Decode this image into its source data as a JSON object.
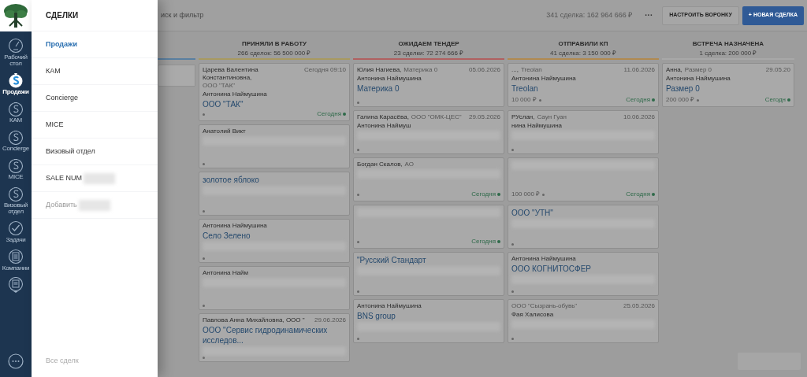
{
  "rail": {
    "items": [
      {
        "label": "Рабочий стол",
        "kind": "dial",
        "selected": false
      },
      {
        "label": "Продажи",
        "kind": "dollar",
        "selected": true
      },
      {
        "label": "КАМ",
        "kind": "dollar",
        "selected": false
      },
      {
        "label": "Concierge",
        "kind": "dollar",
        "selected": false
      },
      {
        "label": "MICE",
        "kind": "dollar",
        "selected": false
      },
      {
        "label": "Визовый отдел",
        "kind": "dollar",
        "selected": false
      },
      {
        "label": "Задачи",
        "kind": "check",
        "selected": false
      },
      {
        "label": "Компании",
        "kind": "list",
        "selected": false
      },
      {
        "kind": "more",
        "selected": false
      }
    ]
  },
  "menu": {
    "title": "СДЕЛКИ",
    "items": [
      {
        "label": "Продажи",
        "kind": "pipeline",
        "selected": true,
        "blurred": false
      },
      {
        "label": "КАМ",
        "kind": "pipeline",
        "selected": false,
        "blurred": false
      },
      {
        "label": "Concierge",
        "kind": "pipeline",
        "selected": false,
        "blurred": false
      },
      {
        "label": "MICE",
        "kind": "pipeline",
        "selected": false,
        "blurred": false
      },
      {
        "label": "Визовый отдел",
        "kind": "pipeline",
        "selected": false,
        "blurred": false
      },
      {
        "label": "SALE NUM",
        "kind": "pipeline",
        "selected": false,
        "blurred": true
      },
      {
        "label": "Добавить",
        "kind": "add",
        "selected": false,
        "blurred": true
      }
    ],
    "footer": "Все сделк"
  },
  "toolbar": {
    "search_placeholder": "иск и фильтр",
    "summary": "341 сделка: 162 964 666 ₽",
    "more": "···",
    "buttons": [
      {
        "label": "НАСТРОИТЬ ВОРОНКУ",
        "kind": "secondary"
      },
      {
        "label": "+ НОВАЯ СДЕЛКА",
        "kind": "primary"
      }
    ]
  },
  "hidden_column": {
    "color": "#5a7fa0"
  },
  "columns": [
    {
      "title": "ПРИНЯЛИ В РАБОТУ",
      "summary": "266 сделок: 56 500 000 ₽",
      "color": "#a89a60",
      "cards": [
        {
          "contact": "Царева Валентина Константиновна,",
          "company": "ООО \"ТАК\"",
          "date": "Сегодня 09:10",
          "manager": "Антонина Наймушина",
          "title": "ООО \"ТАК\"",
          "due": "Сегодня",
          "blurred": false
        },
        {
          "contact": "Анатолий Викт",
          "blurred": true
        },
        {
          "title": "золотое яблоко",
          "blurred": true
        },
        {
          "manager": "Антонина Наймушина",
          "title": "Село Зелено",
          "blurred": true
        },
        {
          "manager": "Антонина Найм",
          "blurred": true
        },
        {
          "contact": "Павлова Анна Михайловна, ООО \"",
          "date": "29.06.2026",
          "title": "ООО \"Сервис гидродинамических исследов...",
          "blurred": true
        }
      ]
    },
    {
      "title": "ОЖИДАЕМ ТЕНДЕР",
      "summary": "23 сделки: 72 274 666 ₽",
      "color": "#b06060",
      "cards": [
        {
          "contact": "Юлия Нагиева,",
          "company": "Материка 0",
          "date": "05.06.2026",
          "manager": "Антонина Наймушина",
          "title": "Материка 0",
          "blurred": false
        },
        {
          "contact": "Галина Карасёва,",
          "company": "ООО \"ОМК-ЦЕС\"",
          "date": "29.05.2026",
          "manager": "Антонина Наймуш",
          "blurred": true
        },
        {
          "contact": "Богдан Скалов,",
          "company": "АО",
          "due": "Сегодня",
          "blurred": true
        },
        {
          "due": "Сегодня",
          "blurred": true
        },
        {
          "title": "\"Русский Стандарт",
          "blurred": true
        },
        {
          "manager": "Антонина Наймушина",
          "title": "BNS group",
          "blurred": true
        }
      ]
    },
    {
      "title": "ОТПРАВИЛИ КП",
      "summary": "41 сделка: 3 150 000 ₽",
      "color": "#b08a50",
      "cards": [
        {
          "contact": "...,",
          "company": "Treolan",
          "date": "11.06.2026",
          "manager": "Антонина Наймушина",
          "title": "Treolan",
          "amount": "10 000 ₽",
          "due": "Сегодня",
          "blurred": false
        },
        {
          "contact": "РУслан,",
          "company": "Саун Гуан",
          "date": "10.06.2026",
          "manager": "нина Наймушина",
          "blurred": true
        },
        {
          "amount": "100 000 ₽",
          "due": "Сегодня",
          "blurred": true
        },
        {
          "title": "ООО \"УТН\"",
          "blurred": true
        },
        {
          "manager": "Антонина Наймушина",
          "title": "ООО КОГНИТОСФЕР",
          "blurred": true
        },
        {
          "company": "ООО \"Сызрань-обувь\"",
          "date": "25.05.2026",
          "manager": "Фая Халисова",
          "blurred": true
        }
      ]
    },
    {
      "title": "ВСТРЕЧА НАЗНАЧЕНА",
      "summary": "1 сделка: 200 000 ₽",
      "color": "#a8a8a8",
      "cards": [
        {
          "contact": "Анна,",
          "company": "Размер 0",
          "date": "29.05.20",
          "manager": "Антонина Наймушина",
          "title": "Размер 0",
          "amount": "200 000 ₽",
          "due": "Сегодн",
          "blurred": false
        }
      ]
    }
  ]
}
